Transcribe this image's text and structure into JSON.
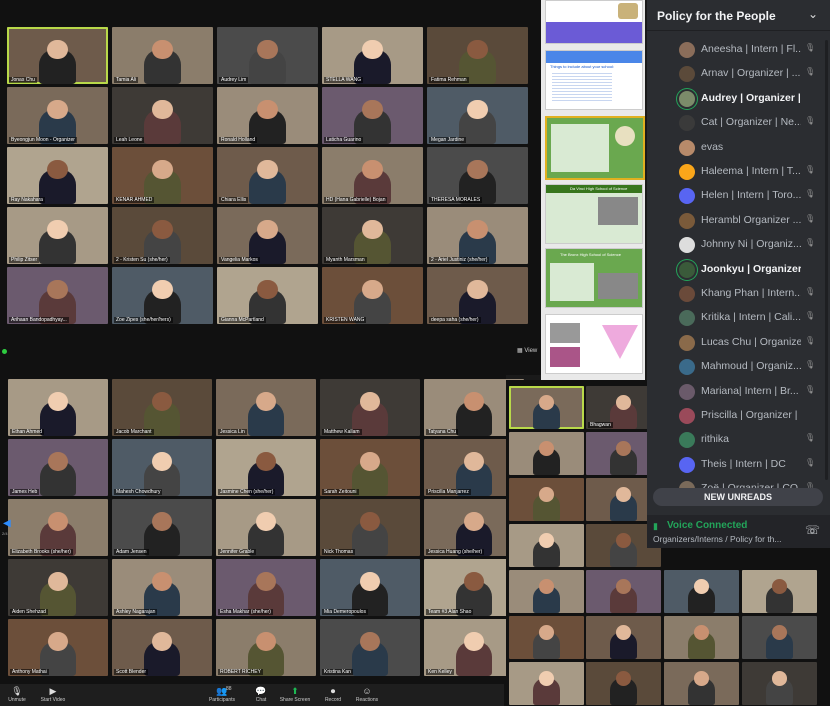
{
  "zoom_top": {
    "view_label": "View",
    "rows": [
      [
        "Jonas Chu",
        "Tamia Ali",
        "Audrey Lim",
        "STELLA WANG",
        "Fatima Rehman"
      ],
      [
        "Byeongjun Moon - Organizer",
        "Leah Leone",
        "Ronald Holland",
        "Laticha Guarino",
        "Megan Jardine"
      ],
      [
        "Ray Nakahara",
        "KENAR AHMED",
        "Chiara Ellis",
        "HD (Hana Gabrielle) Bojan",
        "THERESA MORALES"
      ],
      [
        "Philip Zitser",
        "2 - Kristen Su (she/her)",
        "Vangelia Markos",
        "Myanth Marsman",
        "2 - Ariel Justiniz (she/her)"
      ],
      [
        "Arihaan Bandopadhyay...",
        "Zoe Zipes (she/her/hers)",
        "Gianna McPartland",
        "KRISTEN WANG",
        "deepa saha (she/her)"
      ]
    ]
  },
  "zoom_bottom": {
    "rows": [
      [
        "Ethan Ahmed",
        "Jacob Marchant",
        "Jessica Lin",
        "Matthew Kallam",
        "Tatyana Chu"
      ],
      [
        "James Heb",
        "Mahesh Chowdhury",
        "Jasmine Chen (she/her)",
        "Sarah Zeitouni",
        "Priscilla Manjarrez"
      ],
      [
        "Elizabeth Brooks (she/her)",
        "Adam Jensen",
        "Jennifer Grable",
        "Nick Thomas",
        "Jessica Huang (she/her)"
      ],
      [
        "Aiden Shehzad",
        "Ashley Nagarajan",
        "Esha Makhar (she/her)",
        "Mia Demeropoulos",
        "Team #3 Alan Shao"
      ],
      [
        "Anthony Mathai",
        "Scott Blender",
        "ROBERT RICHEY",
        "Kristina Kan",
        "Ken Kelley"
      ]
    ],
    "toolbar": [
      {
        "label": "Unmute",
        "icon": "microphone-icon"
      },
      {
        "label": "Start Video",
        "icon": "video-icon"
      },
      {
        "label": "Participants",
        "icon": "participants-icon"
      },
      {
        "label": "Chat",
        "icon": "chat-icon"
      },
      {
        "label": "Share Screen",
        "icon": "share-screen-icon"
      },
      {
        "label": "Record",
        "icon": "record-icon"
      },
      {
        "label": "Reactions",
        "icon": "reactions-icon"
      }
    ],
    "participants_count": "88",
    "page_indicator": "2/4"
  },
  "zoom_side": {
    "top_names": [
      "",
      "Bhagwan"
    ]
  },
  "slides": {
    "slide2_title": "Things to include about your school:",
    "slide4_title": "Da Vinci High School of Science",
    "slide5_title": "The Bronx High School of Science"
  },
  "discord": {
    "title": "Policy for the People",
    "members": [
      {
        "name": "Aneesha | Intern | Fl...",
        "bold": false,
        "muted": true,
        "color": "#8a6d5a"
      },
      {
        "name": "Arnav | Organizer | ...",
        "bold": false,
        "muted": true,
        "color": "#5b4a3a"
      },
      {
        "name": "Audrey | Organizer | Wa...",
        "bold": true,
        "muted": false,
        "color": "#7b8b6a"
      },
      {
        "name": "Cat | Organizer | Ne...",
        "bold": false,
        "muted": true,
        "color": "#3a3a3a"
      },
      {
        "name": "evas",
        "bold": false,
        "muted": false,
        "color": "#b78a6a"
      },
      {
        "name": "Haleema | Intern | T...",
        "bold": false,
        "muted": true,
        "color": "#faa61a"
      },
      {
        "name": "Helen | Intern | Toro...",
        "bold": false,
        "muted": true,
        "color": "#5865f2"
      },
      {
        "name": "Herambl Organizer ...",
        "bold": false,
        "muted": true,
        "color": "#7a5a3a"
      },
      {
        "name": "Johnny Ni | Organiz...",
        "bold": false,
        "muted": true,
        "color": "#dddddd"
      },
      {
        "name": "Joonkyu | Organizer | TN",
        "bold": true,
        "muted": false,
        "color": "#3a5a3a"
      },
      {
        "name": "Khang Phan | Intern...",
        "bold": false,
        "muted": true,
        "color": "#6a4a3a"
      },
      {
        "name": "Kritika | Intern | Cali...",
        "bold": false,
        "muted": true,
        "color": "#4a6a5a"
      },
      {
        "name": "Lucas Chu | Organizer | ...",
        "bold": false,
        "muted": true,
        "color": "#8a6a4a"
      },
      {
        "name": "Mahmoud | Organiz...",
        "bold": false,
        "muted": true,
        "color": "#3a6a8a"
      },
      {
        "name": "Mariana| Intern | Br...",
        "bold": false,
        "muted": true,
        "color": "#6a5a6a"
      },
      {
        "name": "Priscilla | Organizer | NJ",
        "bold": false,
        "muted": false,
        "color": "#9a4a5a"
      },
      {
        "name": "rithika",
        "bold": false,
        "muted": true,
        "color": "#3a7a5a"
      },
      {
        "name": "Theis | Intern | DC",
        "bold": false,
        "muted": true,
        "color": "#5865f2"
      },
      {
        "name": "Zoë | Organizer | CO...",
        "bold": false,
        "muted": true,
        "color": "#7a6a5a"
      }
    ],
    "new_unreads": "NEW UNREADS",
    "voice_status": "Voice Connected",
    "voice_channel": "Organizers/Interns / Policy for th...",
    "accent": "#23a55a"
  }
}
